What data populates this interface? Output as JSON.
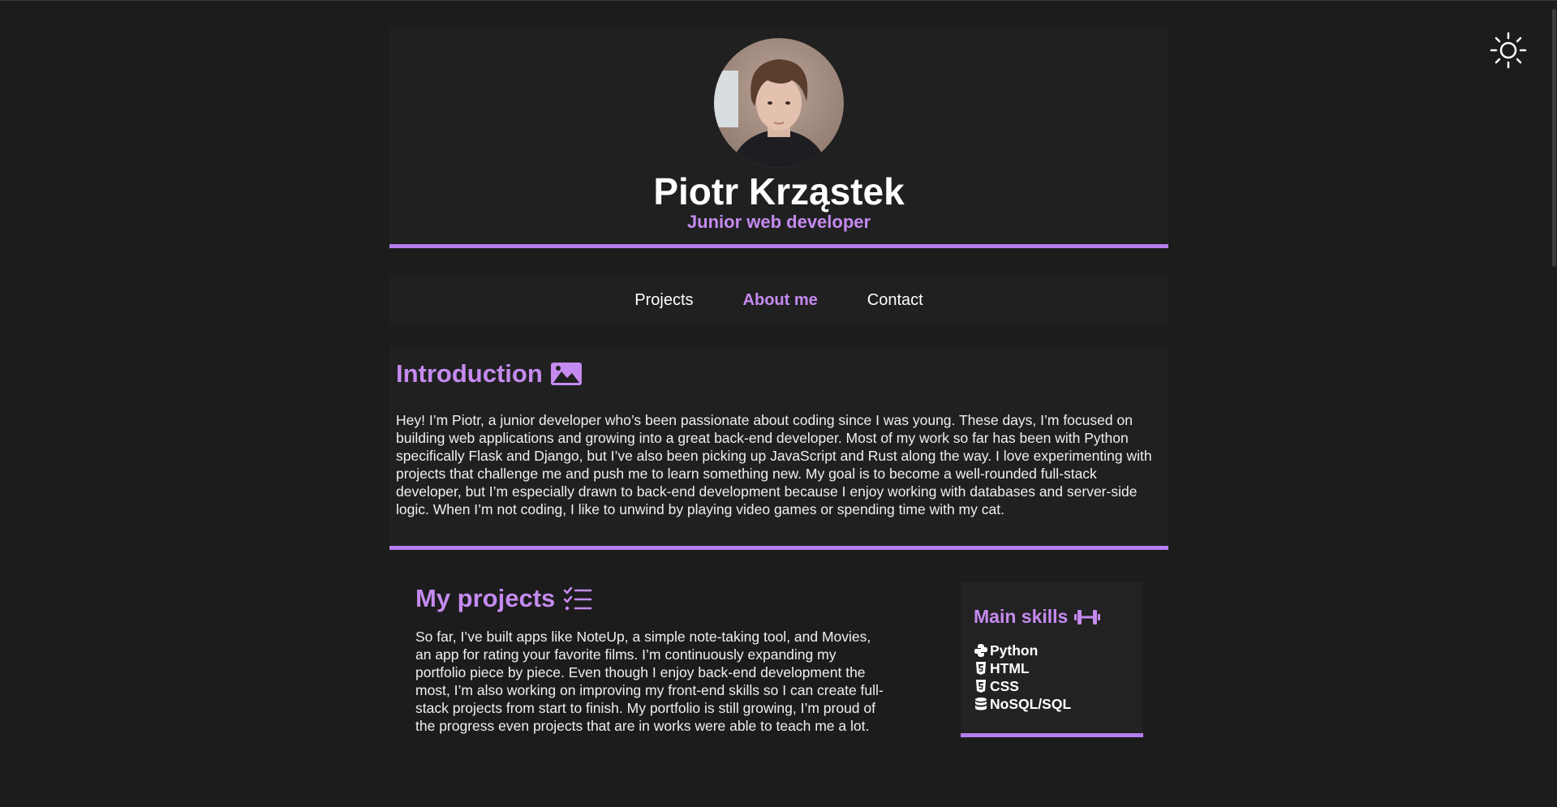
{
  "header": {
    "name": "Piotr Krząstek",
    "role": "Junior web developer",
    "avatar_icon": "profile-photo"
  },
  "theme_toggle": {
    "icon": "sun-icon"
  },
  "nav": {
    "items": [
      {
        "label": "Projects",
        "active": false
      },
      {
        "label": "About me",
        "active": true
      },
      {
        "label": "Contact",
        "active": false
      }
    ]
  },
  "intro": {
    "title": "Introduction",
    "icon": "image-icon",
    "text": "Hey! I’m Piotr, a junior developer who’s been passionate about coding since I was young. These days, I’m focused on building web applications and growing into a great back-end developer. Most of my work so far has been with Python specifically Flask and Django, but I’ve also been picking up JavaScript and Rust along the way. I love experimenting with projects that challenge me and push me to learn something new. My goal is to become a well-rounded full-stack developer, but I’m especially drawn to back-end development because I enjoy working with databases and server-side logic. When I’m not coding, I like to unwind by playing video games or spending time with my cat."
  },
  "projects": {
    "title": "My projects",
    "icon": "list-check-icon",
    "text": "So far, I’ve built apps like NoteUp, a simple note-taking tool, and Movies, an app for rating your favorite films. I’m continuously expanding my portfolio piece by piece. Even though I enjoy back-end development the most, I’m also working on improving my front-end skills so I can create full-stack projects from start to finish. My portfolio is still growing, I’m proud of the progress even projects that are in works were able to teach me a lot."
  },
  "skills": {
    "title": "Main skills",
    "icon": "dumbbell-icon",
    "items": [
      {
        "label": "Python",
        "icon": "python-icon"
      },
      {
        "label": "HTML",
        "icon": "html5-icon"
      },
      {
        "label": "CSS",
        "icon": "css3-icon"
      },
      {
        "label": "NoSQL/SQL",
        "icon": "database-icon"
      }
    ]
  },
  "colors": {
    "accent": "#b57eee",
    "accent_text": "#c58af0",
    "background": "#1c1c1c",
    "panel": "#202020"
  }
}
